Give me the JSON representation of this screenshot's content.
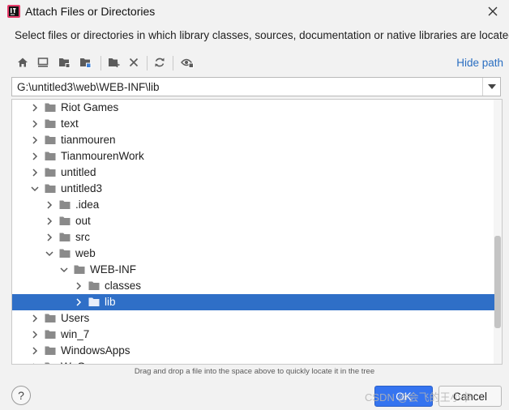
{
  "dialog": {
    "title": "Attach Files or Directories",
    "description": "Select files or directories in which library classes, sources, documentation or native libraries are located"
  },
  "toolbar": {
    "hide_path_label": "Hide path",
    "buttons": [
      "home-icon",
      "desktop-icon",
      "project-folder-icon",
      "module-folder-icon",
      "new-folder-icon",
      "delete-icon",
      "refresh-icon",
      "show-hidden-icon"
    ]
  },
  "path": {
    "value": "G:\\untitled3\\web\\WEB-INF\\lib"
  },
  "tree": {
    "rows": [
      {
        "label": "Riot Games",
        "depth": 0,
        "expanded": false,
        "selected": false
      },
      {
        "label": "text",
        "depth": 0,
        "expanded": false,
        "selected": false
      },
      {
        "label": "tianmouren",
        "depth": 0,
        "expanded": false,
        "selected": false
      },
      {
        "label": "TianmourenWork",
        "depth": 0,
        "expanded": false,
        "selected": false
      },
      {
        "label": "untitled",
        "depth": 0,
        "expanded": false,
        "selected": false
      },
      {
        "label": "untitled3",
        "depth": 0,
        "expanded": true,
        "selected": false
      },
      {
        "label": ".idea",
        "depth": 1,
        "expanded": false,
        "selected": false
      },
      {
        "label": "out",
        "depth": 1,
        "expanded": false,
        "selected": false
      },
      {
        "label": "src",
        "depth": 1,
        "expanded": false,
        "selected": false
      },
      {
        "label": "web",
        "depth": 1,
        "expanded": true,
        "selected": false
      },
      {
        "label": "WEB-INF",
        "depth": 2,
        "expanded": true,
        "selected": false
      },
      {
        "label": "classes",
        "depth": 3,
        "expanded": false,
        "selected": false
      },
      {
        "label": "lib",
        "depth": 3,
        "expanded": false,
        "selected": true
      },
      {
        "label": "Users",
        "depth": 0,
        "expanded": false,
        "selected": false
      },
      {
        "label": "win_7",
        "depth": 0,
        "expanded": false,
        "selected": false
      },
      {
        "label": "WindowsApps",
        "depth": 0,
        "expanded": false,
        "selected": false
      },
      {
        "label": "WeGame",
        "depth": 0,
        "expanded": false,
        "selected": false
      }
    ]
  },
  "hint": "Drag and drop a file into the space above to quickly locate it in the tree",
  "footer": {
    "help_label": "?",
    "ok_label": "OK",
    "cancel_label": "Cancel",
    "watermark": "CSDN @会飞的王小卡"
  },
  "colors": {
    "accent": "#3574f0",
    "selection": "#2f6fc7",
    "link": "#2a6ec1",
    "folder": "#8a8a8a"
  }
}
